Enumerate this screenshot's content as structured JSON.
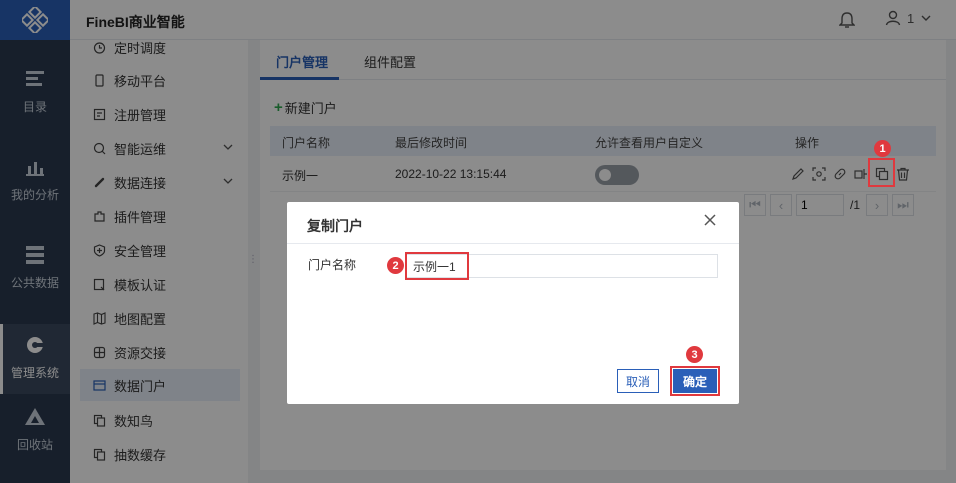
{
  "app": {
    "title": "FineBI商业智能",
    "user_name": "1"
  },
  "leftnav": [
    {
      "label": "目录",
      "icon": "catalog-icon"
    },
    {
      "label": "我的分析",
      "icon": "analysis-icon"
    },
    {
      "label": "公共数据",
      "icon": "public-data-icon"
    },
    {
      "label": "管理系统",
      "icon": "management-icon",
      "active": true
    },
    {
      "label": "回收站",
      "icon": "recycle-bin-icon"
    }
  ],
  "submenu": [
    {
      "label": "定时调度",
      "icon": "timer-icon"
    },
    {
      "label": "移动平台",
      "icon": "mobile-icon"
    },
    {
      "label": "注册管理",
      "icon": "register-icon"
    },
    {
      "label": "智能运维",
      "icon": "ops-icon",
      "expandable": true
    },
    {
      "label": "数据连接",
      "icon": "link-icon",
      "expandable": true
    },
    {
      "label": "插件管理",
      "icon": "plugin-icon"
    },
    {
      "label": "安全管理",
      "icon": "shield-icon"
    },
    {
      "label": "模板认证",
      "icon": "template-icon"
    },
    {
      "label": "地图配置",
      "icon": "map-icon"
    },
    {
      "label": "资源交接",
      "icon": "resource-icon"
    },
    {
      "label": "数据门户",
      "icon": "portal-icon",
      "active": true
    },
    {
      "label": "数知鸟",
      "icon": "bird-icon"
    },
    {
      "label": "抽数缓存",
      "icon": "cache-icon"
    }
  ],
  "tabs": [
    {
      "label": "门户管理",
      "active": true
    },
    {
      "label": "组件配置"
    }
  ],
  "toolbar": {
    "new_portal": "新建门户"
  },
  "table": {
    "headers": [
      "门户名称",
      "最后修改时间",
      "允许查看用户自定义",
      "操作"
    ],
    "rows": [
      {
        "name": "示例一",
        "modified": "2022-10-22 13:15:44",
        "allow_custom": false
      }
    ]
  },
  "pager": {
    "current": "1",
    "total": "/1"
  },
  "modal": {
    "title": "复制门户",
    "field_label": "门户名称",
    "field_value": "示例一1",
    "cancel": "取消",
    "confirm": "确定"
  },
  "annotations": {
    "step1": "1",
    "step2": "2",
    "step3": "3"
  },
  "colors": {
    "primary": "#2a5fb8",
    "highlight": "#e0393e",
    "nav_bg": "#2b3a4f"
  }
}
